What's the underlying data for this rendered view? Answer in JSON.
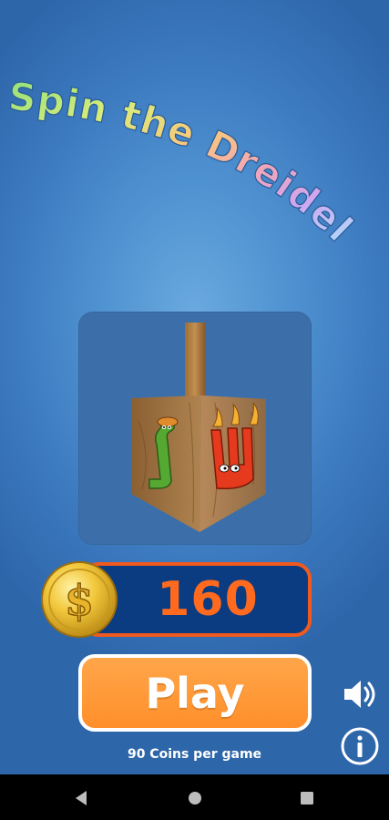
{
  "title": {
    "text": "Spin the Dreidel",
    "colors": [
      "#8ee07a",
      "#b9e86a",
      "#f6e06a",
      "#f6b86a",
      "#f4a0a8",
      "#e6a0e6",
      "#a8c8f6",
      "#b6f0ff"
    ]
  },
  "dreidel": {
    "letters": [
      "gimel-character",
      "shin-character"
    ],
    "wood_color": "#a0733f"
  },
  "balance": {
    "coins": "160",
    "coin_symbol": "$"
  },
  "play": {
    "label": "Play",
    "cost_text": "90 Coins per game"
  },
  "controls": {
    "sound_icon": "speaker-icon",
    "info_icon": "info-icon"
  },
  "system_nav": {
    "back_icon": "back-triangle-icon",
    "home_icon": "home-circle-icon",
    "recents_icon": "recents-square-icon"
  },
  "colors": {
    "background": "#4f92d1",
    "panel": "#3c6fa9",
    "balance_fill": "#0b3c82",
    "balance_border": "#f05a1e",
    "balance_text": "#ff6a1e",
    "play_fill": "#ff9a34",
    "play_border": "#ffffff"
  }
}
